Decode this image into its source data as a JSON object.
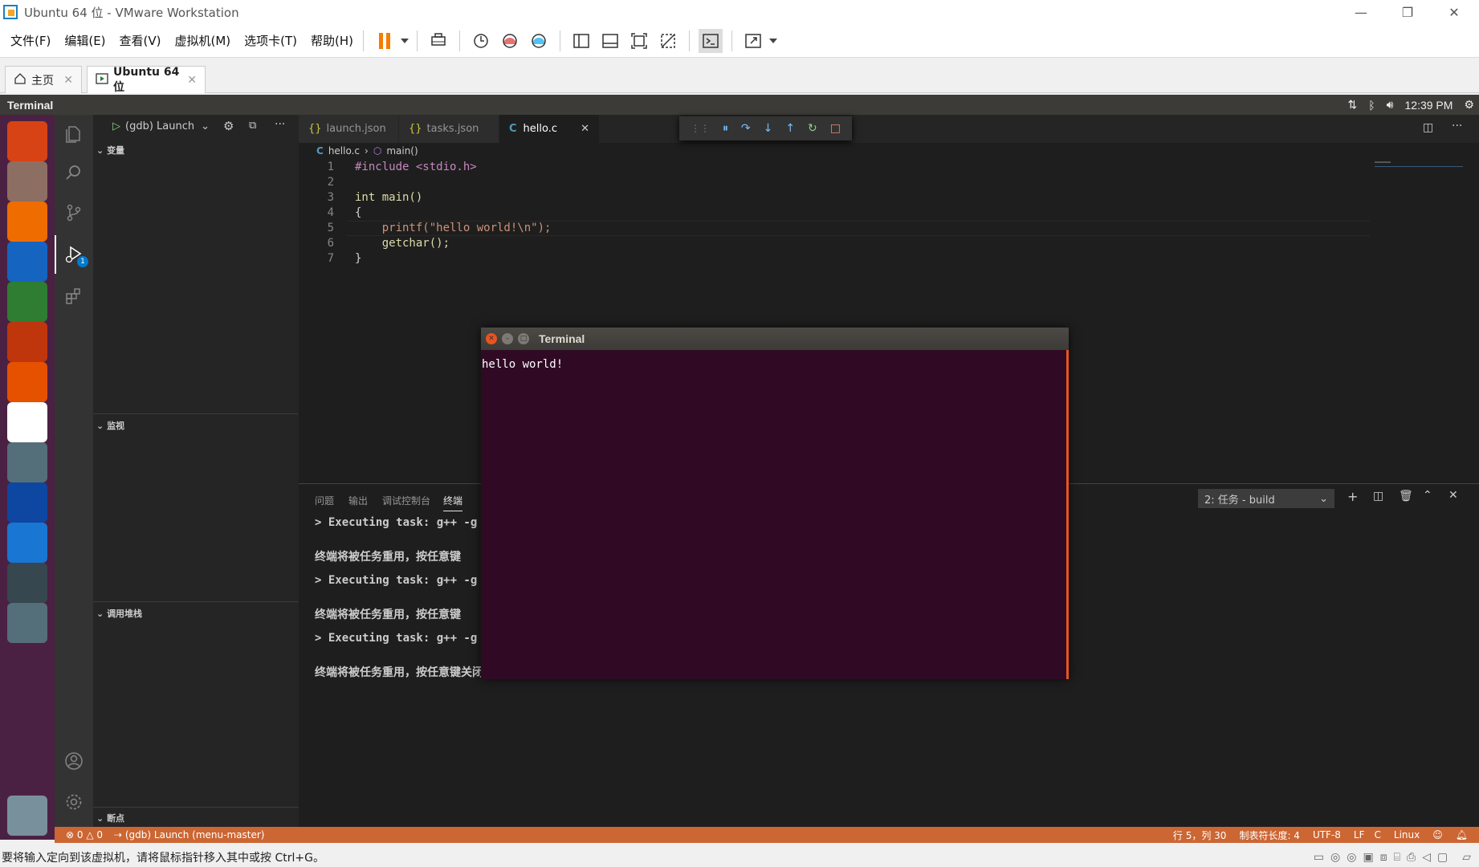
{
  "window": {
    "title": "Ubuntu 64 位 - VMware Workstation",
    "min": "—",
    "restore": "❐",
    "close": "✕"
  },
  "menubar": {
    "items": [
      "文件(F)",
      "编辑(E)",
      "查看(V)",
      "虚拟机(M)",
      "选项卡(T)",
      "帮助(H)"
    ],
    "pause_color": "#f57c00"
  },
  "vm_tabs": {
    "home": "主页",
    "vm": "Ubuntu 64 位"
  },
  "ubuntu_panel": {
    "app_name": "Terminal",
    "time": "12:39 PM"
  },
  "launcher": {
    "items": [
      {
        "name": "ubuntu-dash-icon",
        "color": "#d84315"
      },
      {
        "name": "files-icon",
        "color": "#8d6e63"
      },
      {
        "name": "firefox-icon",
        "color": "#ef6c00"
      },
      {
        "name": "writer-icon",
        "color": "#1565c0"
      },
      {
        "name": "calc-icon",
        "color": "#2e7d32"
      },
      {
        "name": "impress-icon",
        "color": "#bf360c"
      },
      {
        "name": "software-center-icon",
        "color": "#e65100"
      },
      {
        "name": "amazon-icon",
        "color": "#ffffff"
      },
      {
        "name": "system-settings-icon",
        "color": "#546e7a"
      },
      {
        "name": "vscode-icon",
        "color": "#0d47a1"
      },
      {
        "name": "vscode-insiders-icon",
        "color": "#1976d2"
      },
      {
        "name": "terminal-icon",
        "color": "#37474f"
      },
      {
        "name": "save-disk-icon",
        "color": "#546e7a"
      },
      {
        "name": "trash-icon",
        "color": "#78909c"
      }
    ]
  },
  "debug": {
    "config": "(gdb) Launch",
    "sections": {
      "variables": "变量",
      "watch": "监视",
      "callstack": "调用堆栈",
      "breakpoints": "断点"
    },
    "badge": "1"
  },
  "editor": {
    "tabs": [
      "launch.json",
      "tasks.json",
      "hello.c"
    ],
    "tab_prefixes": [
      "{}",
      "{}",
      "C"
    ],
    "breadcrumb": {
      "file": "hello.c",
      "symbol": "main()"
    },
    "line_numbers": [
      "1",
      "2",
      "3",
      "4",
      "5",
      "6",
      "7"
    ],
    "lines": [
      "#include <stdio.h>",
      "",
      "int main()",
      "{",
      "    printf(\"hello world!\\n\");",
      "    getchar();",
      "}"
    ]
  },
  "panel": {
    "tabs": [
      "问题",
      "输出",
      "调试控制台",
      "终端"
    ],
    "active_tab": "终端",
    "terminal_select": "2: 任务 - build",
    "lines": [
      "> Executing task: g++ -g /",
      "终端将被任务重用，按任意键",
      "> Executing task: g++ -g /",
      "终端将被任务重用，按任意键",
      "> Executing task: g++ -g /",
      "终端将被任务重用，按任意键关闭。"
    ]
  },
  "float_terminal": {
    "title": "Terminal",
    "output": "hello world!"
  },
  "statusbar": {
    "errors": "⊗ 0 △ 0",
    "debug": "(gdb) Launch (menu-master)",
    "position": "行 5，列 30",
    "tab_size": "制表符长度: 4",
    "encoding": "UTF-8",
    "eol": "LF",
    "language": "C",
    "os": "Linux"
  },
  "vm_status": {
    "message": "要将输入定向到该虚拟机，请将鼠标指针移入其中或按 Ctrl+G。"
  }
}
